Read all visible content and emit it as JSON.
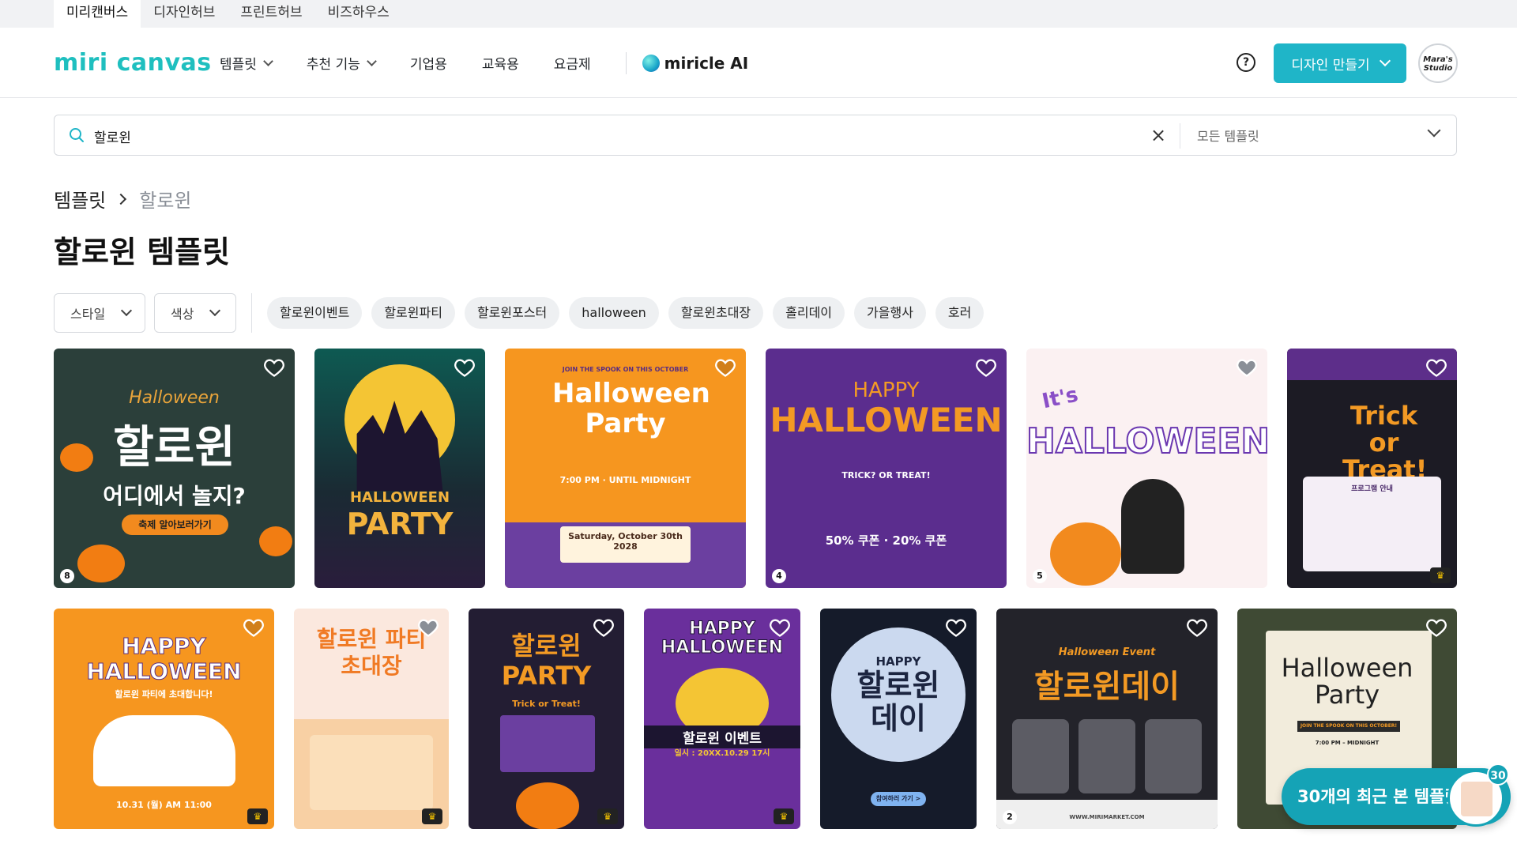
{
  "top_tabs": [
    "미리캔버스",
    "디자인허브",
    "프린트허브",
    "비즈하우스"
  ],
  "header": {
    "logo": "miri canvas",
    "nav": [
      "템플릿",
      "추천 기능",
      "기업용",
      "교육용",
      "요금제"
    ],
    "mircle": "miricle AI",
    "help": "?",
    "create_label": "디자인 만들기",
    "avatar_text": "Mara's Studio"
  },
  "search": {
    "value": "할로윈",
    "scope": "모든 템플릿"
  },
  "breadcrumb": [
    "템플릿",
    "할로윈"
  ],
  "page_title": "할로윈 템플릿",
  "filters": [
    "스타일",
    "색상"
  ],
  "chips": [
    "할로윈이벤트",
    "할로윈파티",
    "할로윈포스터",
    "halloween",
    "할로윈초대장",
    "홀리데이",
    "가을행사",
    "호러"
  ],
  "cards_row1": [
    {
      "title": "할로윈",
      "sub": "어디에서 놀지?",
      "extra": "축제 알아보러가기",
      "script": "Halloween",
      "badge": "8"
    },
    {
      "title": "PARTY",
      "sub": "HALLOWEEN",
      "extra": ""
    },
    {
      "title": "Halloween Party",
      "sub": "Saturday, October 30th 2028",
      "extra": "7:00 PM · UNTIL MIDNIGHT",
      "script": "JOIN THE SPOOK ON THIS OCTOBER"
    },
    {
      "title": "HALLOWEEN",
      "sub": "TRICK? OR TREAT!",
      "extra": "50% 쿠폰 · 20% 쿠폰",
      "script": "HAPPY",
      "badge": "4"
    },
    {
      "title": "HALLOWEEN",
      "sub": "",
      "extra": "",
      "script": "It's",
      "badge": "5"
    },
    {
      "title": "Trick or Treat!",
      "sub": "프로그램 안내",
      "extra": ""
    }
  ],
  "cards_row2": [
    {
      "title": "HAPPY HALLOWEEN",
      "sub": "할로윈 파티에 초대합니다!",
      "extra": "10.31 (월) AM 11:00"
    },
    {
      "title": "할로윈 파티 초대장",
      "sub": "",
      "extra": ""
    },
    {
      "title": "할로윈 PARTY",
      "sub": "Trick or Treat!",
      "extra": ""
    },
    {
      "title": "HAPPY HALLOWEEN",
      "sub": "할로윈 이벤트",
      "extra": "일시 : 20XX.10.29 17시"
    },
    {
      "title": "할로윈 데이",
      "sub": "HAPPY",
      "extra": "참여하러 가기 >"
    },
    {
      "title": "할로윈데이",
      "sub": "Halloween Event",
      "extra": "WWW.MIRIMARKET.COM",
      "badge": "2"
    },
    {
      "title": "Halloween Party",
      "sub": "JOIN THE SPOOK ON THIS OCTOBER!",
      "extra": "7:00 PM – MIDNIGHT"
    }
  ],
  "recent": {
    "label": "30개의 최근 본 템플릿",
    "count": "30"
  },
  "colors": {
    "accent": "#1fb5c8",
    "chip_bg": "#eef0f2"
  }
}
